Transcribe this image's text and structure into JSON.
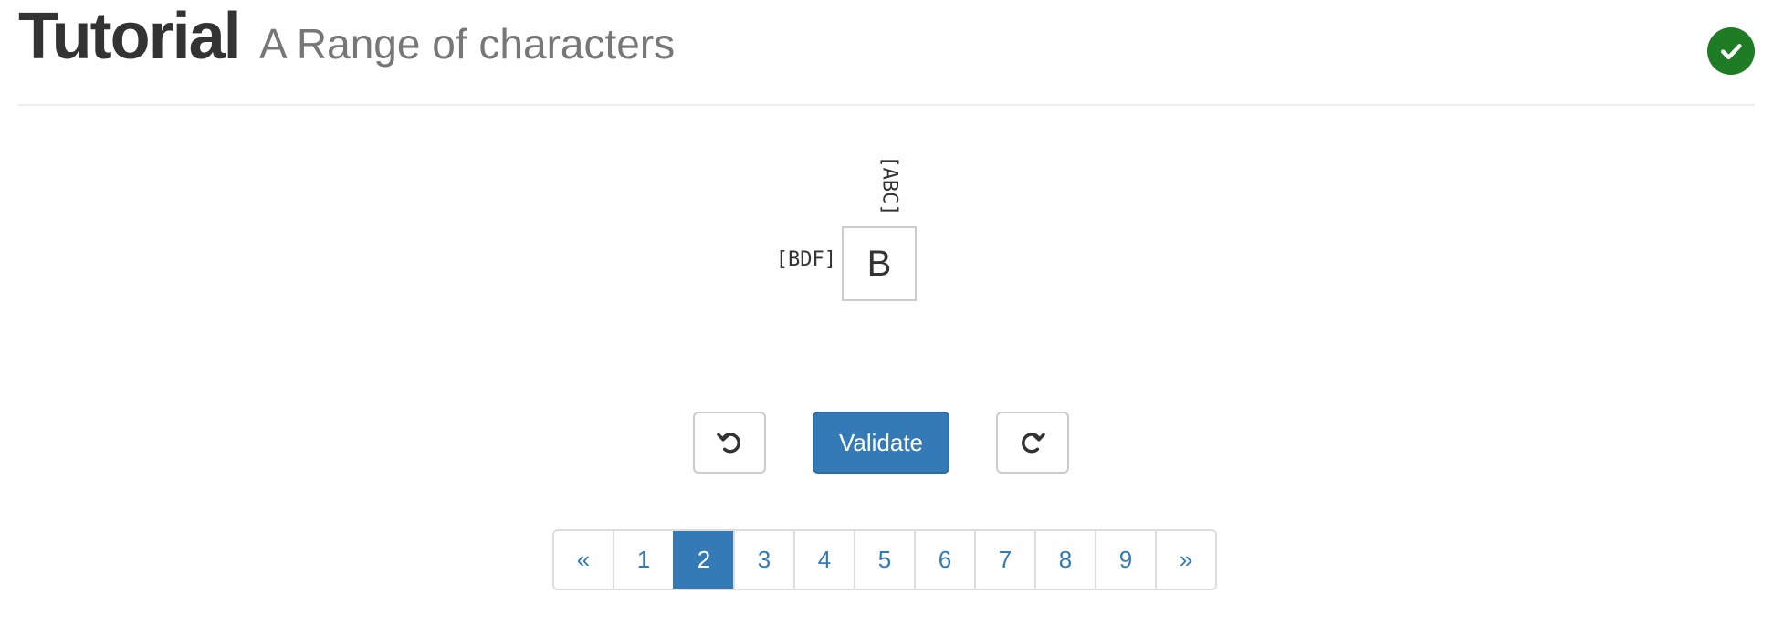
{
  "header": {
    "title": "Tutorial",
    "subtitle": "A Range of characters",
    "status_icon": "check-circle-icon",
    "status_color": "#1e7d24"
  },
  "puzzle": {
    "column_clue": "[ABC]",
    "row_clue": "[BDF]",
    "cell_value": "B"
  },
  "controls": {
    "undo_icon": "undo-icon",
    "validate_label": "Validate",
    "redo_icon": "redo-icon",
    "accent_color": "#337ab7"
  },
  "pagination": {
    "prev_label": "«",
    "next_label": "»",
    "pages": [
      "1",
      "2",
      "3",
      "4",
      "5",
      "6",
      "7",
      "8",
      "9"
    ],
    "current_page": "2"
  }
}
